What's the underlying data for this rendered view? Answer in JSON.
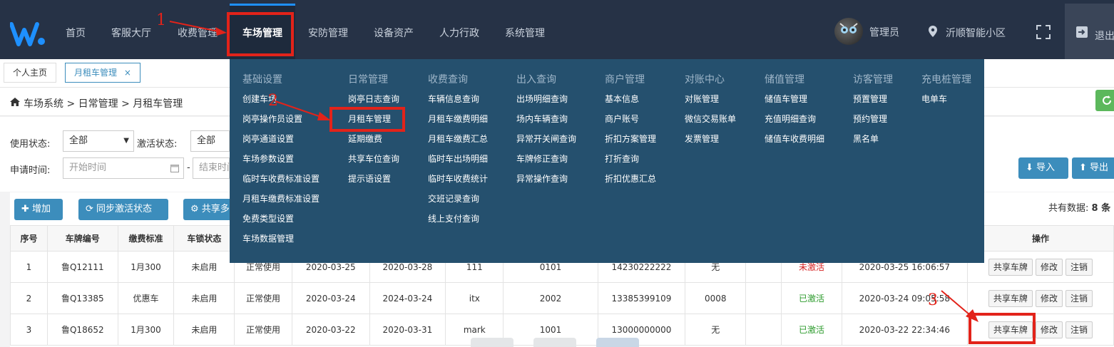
{
  "nav": {
    "items": [
      "首页",
      "客服大厅",
      "收费管理",
      "车场管理",
      "安防管理",
      "设备资产",
      "人力行政",
      "系统管理"
    ],
    "active": "车场管理",
    "user": "管理员",
    "location": "沂顺智能小区",
    "logout": "退出"
  },
  "tabs": [
    {
      "label": "个人主页"
    },
    {
      "label": "月租车管理",
      "close": "×"
    }
  ],
  "breadcrumb": {
    "text": "车场系统  >  日常管理  >  月租车管理"
  },
  "filters": {
    "status_label": "使用状态:",
    "status_value": "全部",
    "activate_label": "激活状态:",
    "activate_value": "全部",
    "date_label": "申请时间:",
    "start_placeholder": "开始时间",
    "dash": "-",
    "end_placeholder": "结束时间"
  },
  "toolbar": {
    "add": "增加",
    "sync": "同步激活状态",
    "share": "共享多",
    "import": "导入",
    "export": "导出",
    "total_label": "共有数据:",
    "total_value": "8 条"
  },
  "mega_menu": {
    "columns": [
      {
        "title": "基础设置",
        "items": [
          "创建车场",
          "岗亭操作员设置",
          "岗亭通道设置",
          "车场参数设置",
          "临时车收费标准设置",
          "月租车缴费标准设置",
          "免费类型设置",
          "车场数据管理"
        ]
      },
      {
        "title": "日常管理",
        "items": [
          "岗亭日志查询",
          "月租车管理",
          "延期缴费",
          "共享车位查询",
          "提示语设置"
        ]
      },
      {
        "title": "收费查询",
        "items": [
          "车辆信息查询",
          "月租车缴费明细",
          "月租车缴费汇总",
          "临时车出场明细",
          "临时车收费统计",
          "交班记录查询",
          "线上支付查询"
        ]
      },
      {
        "title": "出入查询",
        "items": [
          "出场明细查询",
          "场内车辆查询",
          "异常开关闸查询",
          "车牌修正查询",
          "异常操作查询"
        ]
      },
      {
        "title": "商户管理",
        "items": [
          "基本信息",
          "商户账号",
          "折扣方案管理",
          "打折查询",
          "折扣优惠汇总"
        ]
      },
      {
        "title": "对账中心",
        "items": [
          "对账管理",
          "微信交易账单",
          "发票管理"
        ]
      },
      {
        "title": "储值管理",
        "items": [
          "储值车管理",
          "充值明细查询",
          "储值车收费明细"
        ]
      },
      {
        "title": "访客管理",
        "items": [
          "预置管理",
          "预约管理",
          "黑名单"
        ]
      },
      {
        "title": "充电桩管理",
        "items": [
          "电单车"
        ]
      }
    ]
  },
  "table": {
    "headers": [
      "序号",
      "车牌编号",
      "缴费标准",
      "车锁状态",
      "",
      "",
      "",
      "",
      "",
      "",
      "",
      "",
      "",
      "",
      "操作"
    ],
    "rows": [
      [
        "1",
        "鲁Q12111",
        "1月300",
        "未启用",
        "正常使用",
        "2020-03-25",
        "2020-03-28",
        "111",
        "0101",
        "14230222222",
        "无",
        "",
        "未激活",
        "2020-03-25 16:06:57"
      ],
      [
        "2",
        "鲁Q13385",
        "优惠车",
        "未启用",
        "正常使用",
        "2020-03-24",
        "2024-03-24",
        "itx",
        "2002",
        "13385399109",
        "0008",
        "",
        "已激活",
        "2020-03-24 09:05:58"
      ],
      [
        "3",
        "鲁Q18652",
        "1月300",
        "未启用",
        "正常使用",
        "2020-03-22",
        "2020-03-31",
        "mark",
        "1001",
        "13000000000",
        "无",
        "",
        "已激活",
        "2020-03-22 22:34:46"
      ]
    ],
    "ops": [
      "共享车牌",
      "修改",
      "注销"
    ]
  },
  "annotations": {
    "n1": "1",
    "n2": "2",
    "n3": "3"
  },
  "colors": {
    "nav_bg": "#263246",
    "mega_bg": "#25506e",
    "accent": "#3c8dbc",
    "annotation": "#e2231a"
  }
}
